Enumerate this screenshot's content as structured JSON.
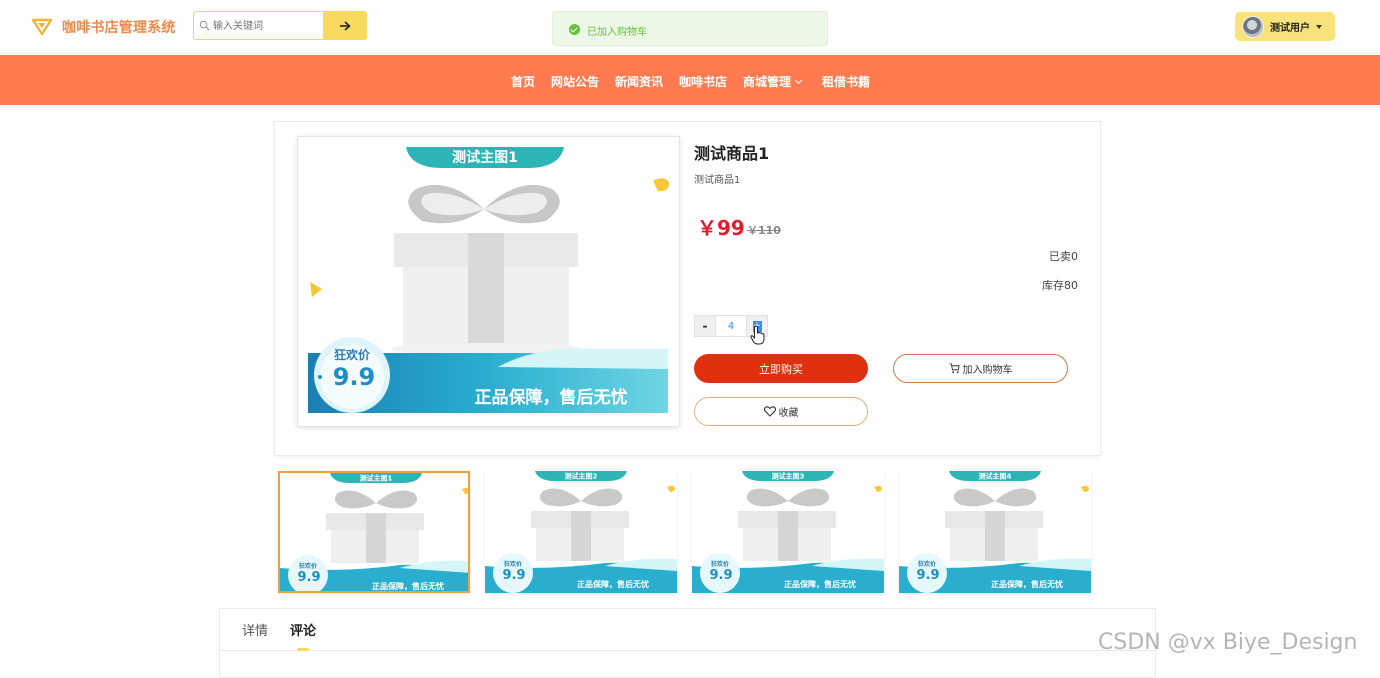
{
  "header": {
    "brand": "咖啡书店管理系统",
    "search": {
      "placeholder": "输入关键词",
      "value": ""
    },
    "user": {
      "name": "测试用户"
    }
  },
  "toast": {
    "message": "已加入购物车",
    "type": "success"
  },
  "nav": {
    "items": [
      {
        "label": "首页"
      },
      {
        "label": "网站公告"
      },
      {
        "label": "新闻资讯"
      },
      {
        "label": "咖啡书店"
      },
      {
        "label": "商城管理",
        "has_dropdown": true
      },
      {
        "label": "租借书籍"
      }
    ]
  },
  "product": {
    "title": "测试商品1",
    "subtitle": "测试商品1",
    "price": "￥99",
    "original_price": "￥110",
    "sold": "已卖0",
    "stock": "库存80",
    "quantity": {
      "minus": "-",
      "value": "4",
      "plus": "+"
    },
    "buttons": {
      "buy": "立即购买",
      "cart": "加入购物车",
      "favorite": "收藏"
    },
    "image": {
      "banner": "测试主图1",
      "badge_top": "狂欢价",
      "badge_price": "9.9",
      "slogan": "正品保障，售后无忧"
    }
  },
  "thumbnails": [
    {
      "banner": "测试主图1",
      "badge_top": "狂欢价",
      "badge_price": "9.9",
      "slogan": "正品保障，售后无忧",
      "active": true
    },
    {
      "banner": "测试主图2",
      "badge_top": "狂欢价",
      "badge_price": "9.9",
      "slogan": "正品保障，售后无忧",
      "active": false
    },
    {
      "banner": "测试主图3",
      "badge_top": "狂欢价",
      "badge_price": "9.9",
      "slogan": "正品保障，售后无忧",
      "active": false
    },
    {
      "banner": "测试主图4",
      "badge_top": "狂欢价",
      "badge_price": "9.9",
      "slogan": "正品保障，售后无忧",
      "active": false
    }
  ],
  "tabs": {
    "items": [
      {
        "label": "详情"
      },
      {
        "label": "评论"
      }
    ],
    "active": "评论"
  },
  "watermark": "CSDN @vx Biye_Design",
  "colors": {
    "nav_bg": "#ff7b4f",
    "brand": "#f08a4b",
    "accent_yellow": "#f9da5e",
    "buy_button": "#e0300f",
    "price_red": "#e41d2c",
    "toast_green": "#67c23a"
  },
  "icons": {
    "logo": "paper-plane-icon",
    "search": "search-icon",
    "search_submit": "arrow-right-icon",
    "toast": "check-circle-icon",
    "user_caret": "caret-down-icon",
    "nav_dropdown": "chevron-down-icon",
    "cart": "cart-icon",
    "favorite": "heart-icon",
    "pointer": "hand-pointer-icon"
  }
}
